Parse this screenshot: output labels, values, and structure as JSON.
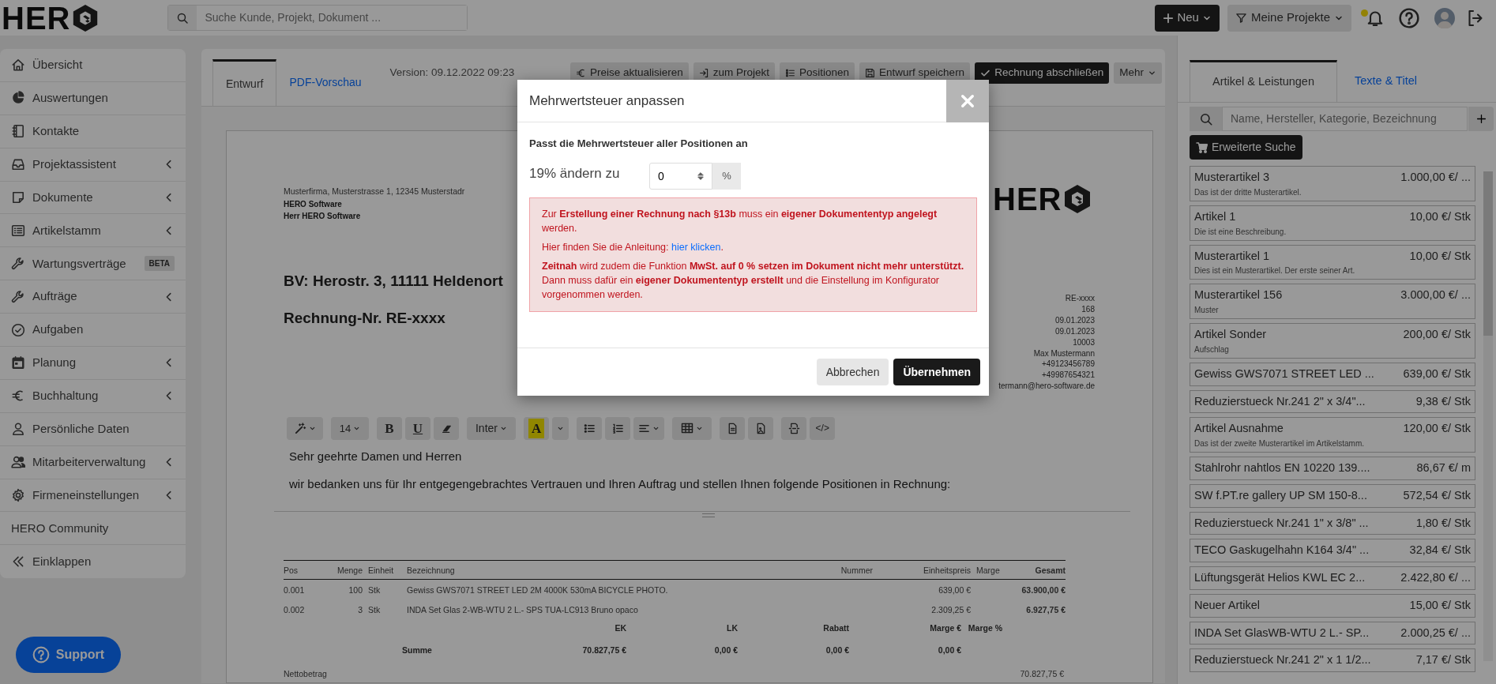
{
  "header": {
    "logo": "HER",
    "search_placeholder": "Suche Kunde, Projekt, Dokument ...",
    "new_button": "Neu",
    "projects_button": "Meine Projekte",
    "notification": true
  },
  "sidebar": {
    "items": [
      {
        "label": "Übersicht",
        "submenu": false
      },
      {
        "label": "Auswertungen",
        "submenu": false
      },
      {
        "label": "Kontakte",
        "submenu": false
      },
      {
        "label": "Projektassistent",
        "submenu": true
      },
      {
        "label": "Dokumente",
        "submenu": true
      },
      {
        "label": "Artikelstamm",
        "submenu": true
      },
      {
        "label": "Wartungsverträge",
        "submenu": false,
        "badge": "BETA"
      },
      {
        "label": "Aufträge",
        "submenu": true
      },
      {
        "label": "Aufgaben",
        "submenu": false
      },
      {
        "label": "Planung",
        "submenu": true
      },
      {
        "label": "Buchhaltung",
        "submenu": true
      },
      {
        "label": "Persönliche Daten",
        "submenu": false
      },
      {
        "label": "Mitarbeiterverwaltung",
        "submenu": true
      },
      {
        "label": "Firmeneinstellungen",
        "submenu": true
      },
      {
        "label": "HERO Community",
        "submenu": false
      },
      {
        "label": "Einklappen",
        "submenu": false
      }
    ],
    "support_button": "Support"
  },
  "editor": {
    "tabs": [
      {
        "label": "Entwurf",
        "selected": true
      },
      {
        "label": "PDF-Vorschau",
        "selected": false
      }
    ],
    "version": "Version: 09.12.2022 09:23",
    "actions": [
      {
        "label": "Preise aktualisieren",
        "kind": "default"
      },
      {
        "label": "zum Projekt",
        "kind": "default"
      },
      {
        "label": "Positionen",
        "kind": "default"
      },
      {
        "label": "Entwurf speichern",
        "kind": "default"
      },
      {
        "label": "Rechnung abschließen",
        "kind": "primary"
      }
    ],
    "more_button": "Mehr"
  },
  "document": {
    "sender_line": "Musterfirma, Musterstrasse 1, 12345 Musterstadr",
    "recipient_lines": [
      "HERO Software",
      "Herr HERO Software"
    ],
    "logo": "HER",
    "project_heading": "BV: Herostr. 3, 11111 Heldenort",
    "invoice_heading": "Rechnung-Nr. RE-xxxx",
    "meta_lines": [
      "RE-xxxx",
      "168",
      "09.01.2023",
      "09.01.2023",
      "10003",
      "Max Mustermann",
      "+49123456789",
      "+49987654321",
      "termann@hero-software.de"
    ],
    "toolbar": {
      "font_size": "14",
      "bold": "B",
      "underline": "U",
      "font": "Inter",
      "highlight": "A",
      "code": "</>"
    },
    "paragraphs": [
      "Sehr geehrte Damen und Herren",
      "wir bedanken uns für Ihr entgegengebrachtes Vertrauen und Ihren Auftrag und stellen Ihnen folgende Positionen in Rechnung:"
    ],
    "table": {
      "columns": [
        "Pos",
        "Menge",
        "Einheit",
        "Bezeichnung",
        "Nummer",
        "Einheitspreis",
        "Marge",
        "Gesamt"
      ],
      "rows": [
        [
          "0.001",
          "100",
          "Stk",
          "Gewiss GWS7071 STREET LED 2M 4000K 530mA BICYCLE PHOTO.",
          "",
          "639,00 €",
          "",
          "63.900,00 €"
        ],
        [
          "0.002",
          "3",
          "Stk",
          "INDA Set Glas 2-WB-WTU 2 L.- SPS TUA-LC913 Bruno opaco",
          "",
          "2.309,25 €",
          "",
          "6.927,75 €"
        ]
      ]
    },
    "summary": {
      "columns": [
        "EK",
        "LK",
        "Rabatt",
        "Marge €",
        "Marge %"
      ],
      "label": "Summe",
      "values": [
        "70.827,75 €",
        "0,00 €",
        "0,00 €",
        "0,00 €"
      ]
    },
    "net": {
      "label": "Nettobetrag",
      "value": "70.827,75 €"
    }
  },
  "articles": {
    "tabs": [
      {
        "label": "Artikel & Leistungen",
        "selected": true
      },
      {
        "label": "Texte & Titel",
        "selected": false
      }
    ],
    "search_placeholder": "Name, Hersteller, Kategorie, Bezeichnung",
    "advanced_search": "Erweiterte Suche",
    "items": [
      {
        "name": "Musterartikel 3",
        "price": "1.000,00 €/ ...",
        "description": "Das ist der dritte Musterartikel."
      },
      {
        "name": "Artikel 1",
        "price": "10,00 €/ Stk",
        "description": "Die ist eine Beschreibung."
      },
      {
        "name": "Musterartikel 1",
        "price": "10,00 €/ Stk",
        "description": "Dies ist ein Musterartikel. Der erste seiner Art."
      },
      {
        "name": "Musterartikel 156",
        "price": "3.000,00 €/ ...",
        "description": "Muster"
      },
      {
        "name": "Artikel Sonder",
        "price": "200,00 €/ Stk",
        "description": "Aufschlag"
      },
      {
        "name": "Gewiss GWS7071 STREET LED ...",
        "price": "639,00 €/ Stk"
      },
      {
        "name": "Reduzierstueck Nr.241 2\" x 3/4\"...",
        "price": "9,38 €/ Stk"
      },
      {
        "name": "Artikel Ausnahme",
        "price": "120,00 €/ Stk",
        "description": "Das ist der zweite Musterartikel im Artikelstamm."
      },
      {
        "name": "Stahlrohr nahtlos EN 10220 139....",
        "price": "86,67 €/ m"
      },
      {
        "name": "SW f.PT.re gallery UP SM 150-8...",
        "price": "572,54 €/ Stk"
      },
      {
        "name": "Reduzierstueck Nr.241 1\" x 3/8\" ...",
        "price": "1,80 €/ Stk"
      },
      {
        "name": "TECO Gaskugelhahn K164 3/4\" ...",
        "price": "32,84 €/ Stk"
      },
      {
        "name": "Lüftungsgerät Helios KWL EC 2...",
        "price": "2.422,80 €/ ..."
      },
      {
        "name": "Neuer Artikel",
        "price": "15,00 €/ Stk"
      },
      {
        "name": "INDA Set GlasWB-WTU 2 L.- SP...",
        "price": "2.000,25 €/ ..."
      },
      {
        "name": "Reduzierstueck Nr.241 2\" x 1 1/2...",
        "price": "7,17 €/ Stk"
      }
    ]
  },
  "modal": {
    "title": "Mehrwertsteuer anpassen",
    "intro": "Passt die Mehrwertsteuer aller Positionen an",
    "field_label": "19% ändern zu",
    "field_value": "0",
    "field_unit": "%",
    "alert": [
      "Zur **Erstellung einer Rechnung nach §13b** muss ein **eigener Dokumententyp angelegt** werden.",
      "Hier finden Sie die Anleitung: ",
      "**Zeitnah** wird zudem die Funktion **MwSt. auf 0 % setzen im Dokument nicht mehr unterstützt.** Dann muss dafür ein **eigener Dokumententyp erstellt** und die Einstellung im Konfigurator vorgenommen werden."
    ],
    "alert_link": "hier klicken",
    "alert_link_suffix": ".",
    "cancel_button": "Abbrechen",
    "confirm_button": "Übernehmen"
  }
}
